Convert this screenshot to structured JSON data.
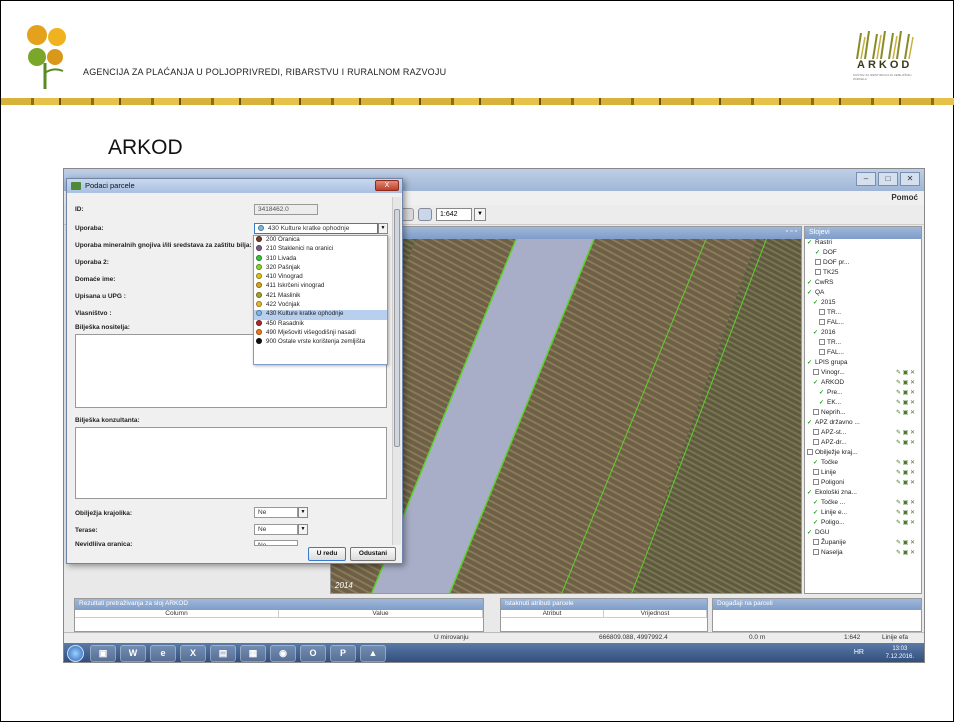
{
  "header": {
    "agency_name": "AGENCIJA ZA PLAĆANJA U POLJOPRIVREDI, RIBARSTVU I RURALNOM RAZVOJU",
    "logo_right_text": "ARKOD",
    "logo_right_sub": "SUSTAV ZA IDENTIFIKACIJU ZEMLJIŠNIH PARCELA"
  },
  "slide": {
    "title": "ARKOD"
  },
  "app": {
    "menu_help": "Pomoć",
    "scale_value": "1:642",
    "map_year": "2014",
    "layers_title": "Slojevi",
    "layers": [
      {
        "label": "Rastri",
        "checked": true
      },
      {
        "label": "DOF",
        "checked": true
      },
      {
        "label": "DOF pr...",
        "checked": false
      },
      {
        "label": "TK25",
        "checked": false
      },
      {
        "label": "CwRS",
        "checked": true
      },
      {
        "label": "QA",
        "checked": true
      },
      {
        "label": "2015",
        "checked": true
      },
      {
        "label": "TR...",
        "checked": false
      },
      {
        "label": "FAL...",
        "checked": false
      },
      {
        "label": "2016",
        "checked": true
      },
      {
        "label": "TR...",
        "checked": false
      },
      {
        "label": "FAL...",
        "checked": false
      },
      {
        "label": "LPIS grupa",
        "checked": true
      },
      {
        "label": "Vinogr...",
        "checked": false
      },
      {
        "label": "ARKOD",
        "checked": true
      },
      {
        "label": "Pre...",
        "checked": true
      },
      {
        "label": "EK...",
        "checked": true
      },
      {
        "label": "Neprih...",
        "checked": false
      },
      {
        "label": "APZ državno ...",
        "checked": true
      },
      {
        "label": "APZ-st...",
        "checked": false
      },
      {
        "label": "APZ-dr...",
        "checked": false
      },
      {
        "label": "Obilježje kraj...",
        "checked": false
      },
      {
        "label": "Točke",
        "checked": true
      },
      {
        "label": "Linije",
        "checked": false
      },
      {
        "label": "Poligoni",
        "checked": false
      },
      {
        "label": "Ekološki zna...",
        "checked": true
      },
      {
        "label": "Točke ...",
        "checked": true
      },
      {
        "label": "Linije e...",
        "checked": true
      },
      {
        "label": "Poligo...",
        "checked": true
      },
      {
        "label": "DGU",
        "checked": true
      },
      {
        "label": "Županije",
        "checked": false
      },
      {
        "label": "Naselja",
        "checked": false
      }
    ],
    "bottom": {
      "results_title": "Rezultati pretraživanja za sloj ARKOD",
      "results_col1": "Column",
      "results_col2": "Value",
      "attrs_title": "Istaknuti atributi parcele",
      "attrs_col1": "Atribut",
      "attrs_col2": "Vrijednost",
      "events_title": "Događaji na parceli"
    },
    "status": {
      "state": "U mirovanju",
      "coords": "666809.088, 4997992.4",
      "distance": "0.0 m",
      "scale": "1:642",
      "mode": "Linije efa"
    },
    "taskbar": {
      "lang": "HR",
      "time": "13:03",
      "date": "7.12.2016."
    }
  },
  "dialog": {
    "title": "Podaci parcele",
    "close": "X",
    "fields": {
      "id_label": "ID:",
      "id_value": "3418462.0",
      "uporaba_label": "Uporaba:",
      "uporaba_value": "430 Kulture kratke ophodnje",
      "mineral_label": "Uporaba mineralnih gnojiva i/ili sredstava za zaštitu bilja:",
      "uporaba2_label": "Uporaba 2:",
      "domace_label": "Domaće ime:",
      "upg_label": "Upisana u UPG :",
      "vlasnistvo_label": "Vlasništvo :",
      "biljeska_nositelja_label": "Bilješka nositelja:",
      "biljeska_konzultanta_label": "Bilješka konzultanta:",
      "obiljezja_label": "Obilježja krajolika:",
      "obiljezja_value": "Ne",
      "terase_label": "Terase:",
      "terase_value": "Ne",
      "next_label": "Nevidljiva granica:",
      "next_value": "Ne"
    },
    "ok_button": "U redu",
    "cancel_button": "Odustani",
    "options": [
      {
        "label": "200 Oranica",
        "color": "#7a3a2a"
      },
      {
        "label": "210 Staklenici na oranici",
        "color": "#7a5a8a"
      },
      {
        "label": "310 Livada",
        "color": "#3ac23a"
      },
      {
        "label": "320 Pašnjak",
        "color": "#8ad42a"
      },
      {
        "label": "410 Vinograd",
        "color": "#d8c21a"
      },
      {
        "label": "411 Iskrčeni vinograd",
        "color": "#d8a21a"
      },
      {
        "label": "421 Maslinik",
        "color": "#a8a22a"
      },
      {
        "label": "422 Voćnjak",
        "color": "#e8b82a"
      },
      {
        "label": "430 Kulture kratke ophodnje",
        "color": "#7ab8e8",
        "selected": true
      },
      {
        "label": "450 Rasadnik",
        "color": "#a82a2a"
      },
      {
        "label": "490 Mješoviti višegodišnji nasadi",
        "color": "#e87a1a"
      },
      {
        "label": "900 Ostale vrste korištenja zemljišta",
        "color": "#111111"
      }
    ]
  }
}
